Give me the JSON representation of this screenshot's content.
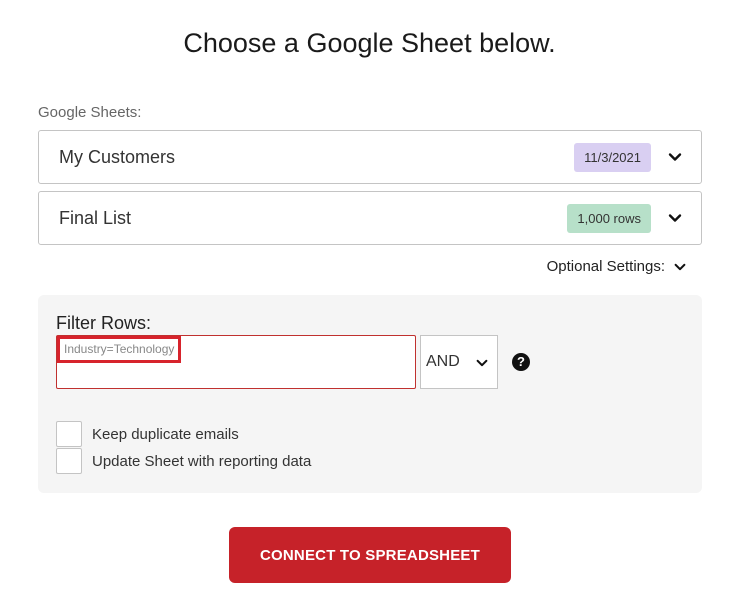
{
  "header": {
    "title": "Choose a Google Sheet below."
  },
  "sheets": {
    "label": "Google Sheets:",
    "dropdowns": [
      {
        "label": "My Customers",
        "badge": "11/3/2021",
        "badge_color": "#d9cff2",
        "icon": "chevron-down-icon"
      },
      {
        "label": "Final List",
        "badge": "1,000 rows",
        "badge_color": "#b7e0c9",
        "icon": "chevron-down-icon"
      }
    ]
  },
  "optional_settings": {
    "label": "Optional Settings:",
    "icon": "chevron-down-icon"
  },
  "filter": {
    "label": "Filter Rows:",
    "input_value": "",
    "placeholder": "Industry=Technology",
    "operator": "AND",
    "help_icon": "question-circle-icon",
    "help_glyph": "?"
  },
  "options": {
    "keep_duplicates": {
      "label": "Keep duplicate emails",
      "checked": false
    },
    "update_sheet": {
      "label": "Update Sheet with reporting data",
      "checked": false
    }
  },
  "actions": {
    "connect_label": "CONNECT TO SPREADSHEET",
    "connect_color": "#c62229"
  }
}
